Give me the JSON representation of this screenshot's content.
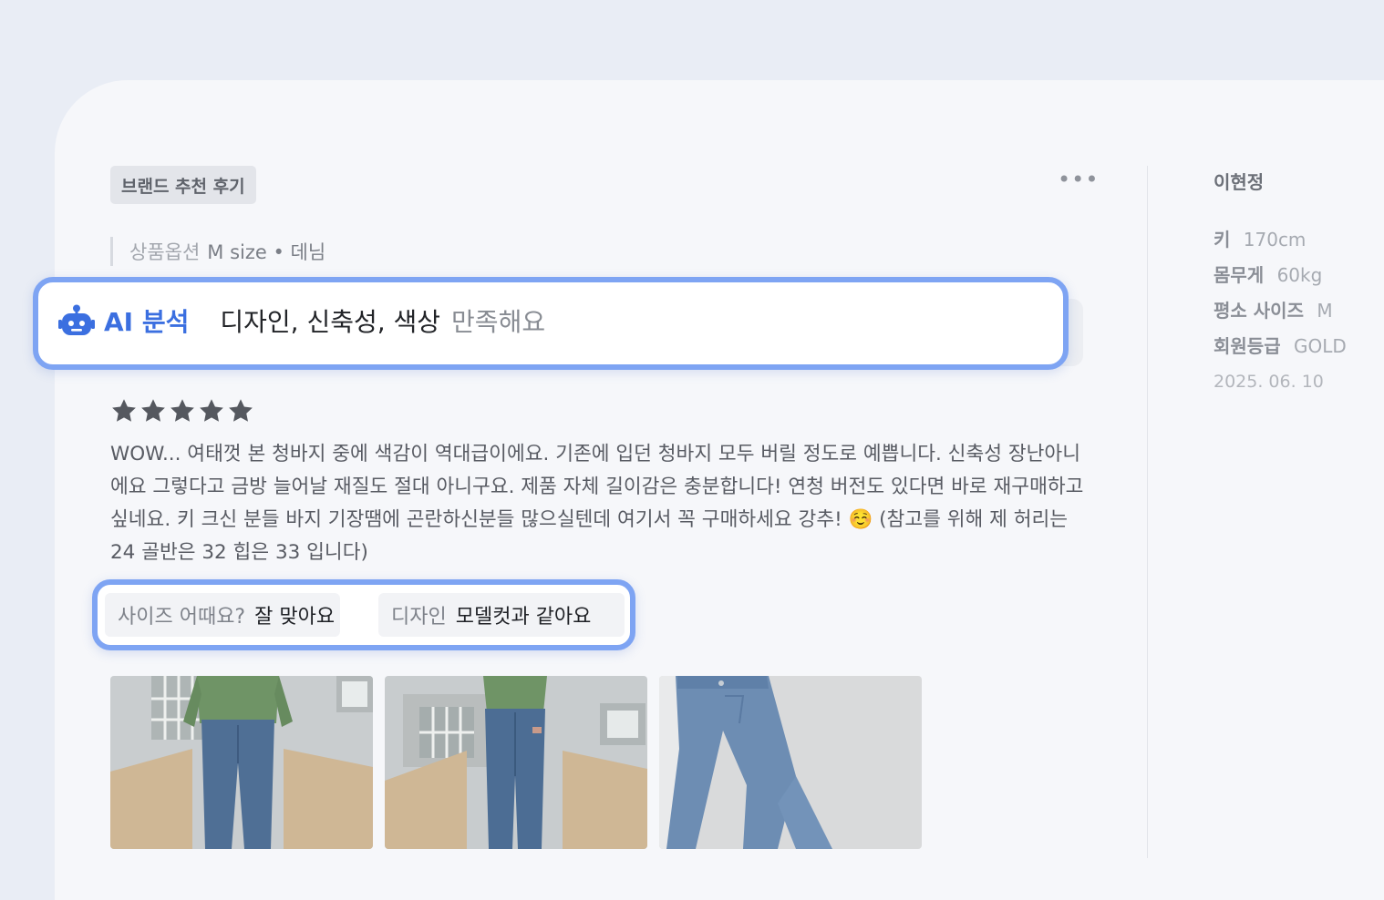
{
  "badge": "브랜드 추천 후기",
  "more_menu": "•••",
  "product_option": {
    "label": "상품옵션",
    "value": "M size • 데님"
  },
  "ai_analysis": {
    "label": "AI 분석",
    "keywords": "디자인, 신축성, 색상",
    "suffix": "만족해요"
  },
  "rating": {
    "stars": 5,
    "max": 5
  },
  "review_text": "WOW... 여태껏 본 청바지 중에 색감이 역대급이에요. 기존에 입던 청바지 모두 버릴 정도로 예쁩니다. 신축성 장난아니에요 그렇다고 금방 늘어날 재질도 절대 아니구요. 제품 자체 길이감은 충분합니다! 연청 버전도 있다면 바로 재구매하고 싶네요. 키 크신 분들 바지 기장땜에 곤란하신분들 많으실텐데 여기서 꼭 구매하세요 강추! ☺️ (참고를 위해 제 허리는 24 골반은 32 힙은 33 입니다)",
  "tags": [
    {
      "question": "사이즈 어때요?",
      "answer": "잘 맞아요"
    },
    {
      "question": "디자인",
      "answer": "모델컷과 같아요"
    }
  ],
  "photos": [
    "front-view-jeans-photo",
    "back-view-jeans-photo",
    "flat-lay-jeans-photo"
  ],
  "reviewer": {
    "name": "이현정",
    "details": [
      {
        "key": "키",
        "value": "170cm"
      },
      {
        "key": "몸무게",
        "value": "60kg"
      },
      {
        "key": "평소 사이즈",
        "value": "M"
      },
      {
        "key": "회원등급",
        "value": "GOLD"
      }
    ],
    "date": "2025. 06. 10"
  },
  "colors": {
    "ai_blue": "#3b6fe0",
    "highlight_border": "#7ea4f3",
    "star": "#55585f"
  },
  "icons": {
    "ai": "robot-icon",
    "star": "star-icon",
    "more": "more-icon"
  }
}
